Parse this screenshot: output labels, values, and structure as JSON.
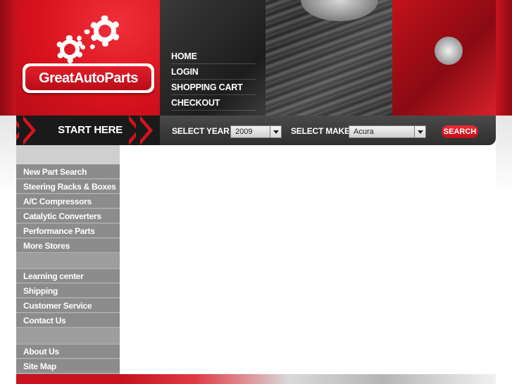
{
  "brand": {
    "logo_text": "GreatAutoParts"
  },
  "top_nav": [
    {
      "label": "HOME"
    },
    {
      "label": "LOGIN"
    },
    {
      "label": "SHOPPING CART"
    },
    {
      "label": "CHECKOUT"
    }
  ],
  "search_bar": {
    "start_label": "START HERE",
    "year_label": "SELECT YEAR:",
    "year_value": "2009",
    "make_label": "SELECT MAKE:",
    "make_value": "Acura",
    "search_button": "SEARCH"
  },
  "sidebar": {
    "group1": [
      {
        "label": "New Part Search"
      },
      {
        "label": "Steering Racks & Boxes"
      },
      {
        "label": "A/C Compressors"
      },
      {
        "label": "Catalytic Converters"
      },
      {
        "label": "Performance Parts"
      },
      {
        "label": "More Stores"
      }
    ],
    "group2": [
      {
        "label": "Learning center"
      },
      {
        "label": "Shipping"
      },
      {
        "label": "Customer  Service"
      },
      {
        "label": "Contact  Us"
      }
    ],
    "group3": [
      {
        "label": "About Us"
      },
      {
        "label": "Site Map"
      }
    ]
  },
  "colors": {
    "brand_red": "#d9121d",
    "bar_dark": "#2e2e2e",
    "sidebar_gray": "#8c8c8c"
  },
  "icons": [
    "gear-icon",
    "chevron-right-icon",
    "dropdown-arrow-icon"
  ]
}
